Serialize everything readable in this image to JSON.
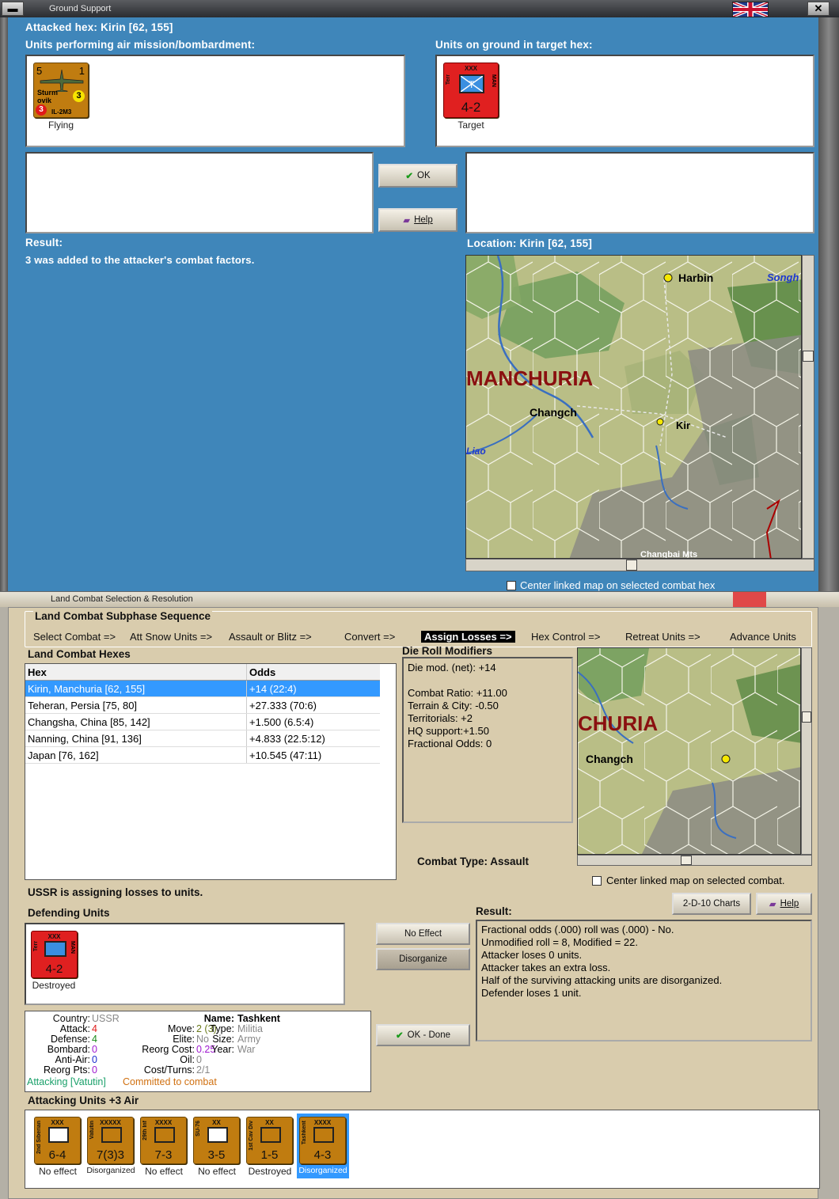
{
  "top_window": {
    "title": "Ground Support",
    "attacked_hex": "Attacked hex: Kirin  [62, 155]",
    "air_units_label": "Units performing air mission/bombardment:",
    "ground_units_label": "Units on ground in target hex:",
    "air_unit": {
      "name_line1": "Sturm",
      "name_line2": "ovik",
      "type": "IL-2M3",
      "tl": "5",
      "tr": "1",
      "badge_yellow": "3",
      "badge_red": "3",
      "caption": "Flying"
    },
    "target_unit": {
      "size": "XXX",
      "side": "Terr",
      "side_right": "MAN",
      "strength": "4-2",
      "caption": "Target"
    },
    "ok_label": "OK",
    "help_label": "Help",
    "result_label": "Result:",
    "result_text": "3 was added to the attacker's combat factors.",
    "location_label": "Location:  Kirin  [62, 155]",
    "center_checkbox": "Center linked map on selected combat hex",
    "map": {
      "harbin": "Harbin",
      "songh": "Songh",
      "manchuria": "MANCHURIA",
      "changch": "Changch",
      "liao": "Liao",
      "changbai": "Changbai Mts",
      "kir": "Kir"
    }
  },
  "bottom_window": {
    "title": "Land Combat Selection & Resolution",
    "sequence_title": "Land Combat Subphase Sequence",
    "sequence": [
      "Select Combat =>",
      "Att Snow Units =>",
      "Assault or Blitz =>",
      "Convert =>",
      "Assign Losses =>",
      "Hex Control =>",
      "Retreat Units =>",
      "Advance Units"
    ],
    "active_step": "Assign Losses =>",
    "hexes_title": "Land Combat Hexes",
    "hexes_columns": [
      "Hex",
      "Odds"
    ],
    "hexes": [
      {
        "hex": "Kirin, Manchuria [62, 155]",
        "odds": "+14 (22:4)"
      },
      {
        "hex": "Teheran, Persia [75, 80]",
        "odds": "+27.333 (70:6)"
      },
      {
        "hex": "Changsha, China [85, 142]",
        "odds": "+1.500 (6.5:4)"
      },
      {
        "hex": "Nanning, China [91, 136]",
        "odds": "+4.833 (22.5:12)"
      },
      {
        "hex": "Japan [76, 162]",
        "odds": "+10.545 (47:11)"
      }
    ],
    "modifiers_title": "Die Roll Modifiers",
    "modifiers": [
      "Die mod. (net): +14",
      "",
      "Combat Ratio: +11.00",
      "Terrain & City: -0.50",
      "Territorials: +2",
      "HQ support:+1.50",
      "Fractional Odds: 0"
    ],
    "combat_type": "Combat Type:  Assault",
    "center_checkbox": "Center linked map on selected combat.",
    "status": "USSR is assigning losses to units.",
    "defending_title": "Defending Units",
    "defender": {
      "size": "XXX",
      "side": "Terr",
      "side_right": "MAN",
      "strength": "4-2",
      "caption": "Destroyed"
    },
    "no_effect_btn": "No Effect",
    "disorganize_btn": "Disorganize",
    "charts_btn": "2-D-10 Charts",
    "help_btn": "Help",
    "ok_done_btn": "OK - Done",
    "result_title": "Result:",
    "result_lines": [
      "Fractional odds (.000) roll was (.000)  - No.",
      "Unmodified roll = 8, Modified = 22.",
      "Attacker loses 0 units.",
      "Attacker takes an extra loss.",
      "Half of the surviving attacking units are disorganized.",
      "Defender loses 1 unit."
    ],
    "unit_info": {
      "country_l": "Country:",
      "country": "USSR",
      "attack_l": "Attack:",
      "attack": "4",
      "defense_l": "Defense:",
      "defense": "4",
      "bombard_l": "Bombard:",
      "bombard": "0",
      "antiair_l": "Anti-Air:",
      "antiair": "0",
      "reorg_l": "Reorg Pts:",
      "reorg": "0",
      "move_l": "Move:",
      "move": "2 (3)",
      "elite_l": "Elite:",
      "elite": "No",
      "reorgcost_l": "Reorg Cost:",
      "reorgcost": "0.25",
      "oil_l": "Oil:",
      "oil": "0",
      "cost_l": "Cost/Turns:",
      "cost": "2/1",
      "name_l": "Name:",
      "name": "Tashkent",
      "type_l": "Type:",
      "type": "Militia",
      "size_l": "Size:",
      "size": "Army",
      "year_l": "Year:",
      "year": "War",
      "attacking": "Attacking [Vatutin]",
      "committed": "Committed to combat"
    },
    "attacking_title": "Attacking Units +3 Air",
    "attackers": [
      {
        "side": "2nd Siberian",
        "size": "XXX",
        "strength": "6-4",
        "caption": "No effect"
      },
      {
        "side": "Vatutin",
        "size": "XXXXX",
        "strength": "7(3)3",
        "caption": "Disorganized"
      },
      {
        "side": "29th Inf",
        "size": "XXXX",
        "strength": "7-3",
        "caption": "No effect"
      },
      {
        "side": "SU-76",
        "size": "XX",
        "strength": "3-5",
        "caption": "No effect"
      },
      {
        "side": "1st Cav Div",
        "size": "XX",
        "strength": "1-5",
        "caption": "Destroyed"
      },
      {
        "side": "Tashkent",
        "size": "XXXX",
        "strength": "4-3",
        "caption": "Disorganized"
      }
    ]
  },
  "colors": {
    "water": "#3f86ba",
    "panel": "#d9ccad",
    "counter": "#c07c10",
    "selection": "#3399ff"
  }
}
